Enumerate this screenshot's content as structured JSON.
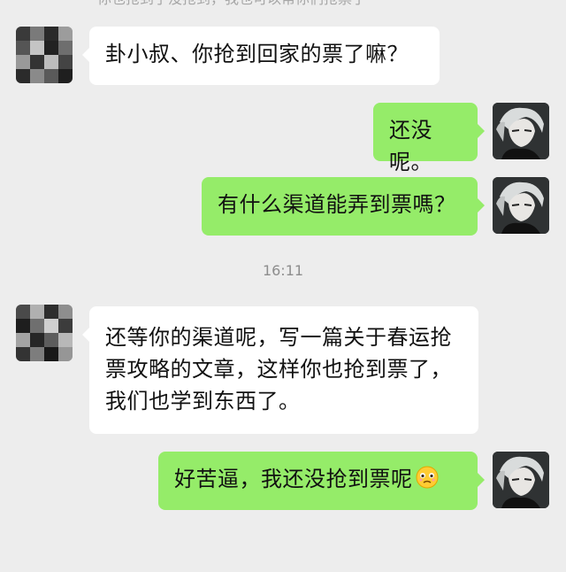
{
  "chat": {
    "top_partial_text": "你也抢到了没抢到，我也可以帮你们抢票了",
    "messages": [
      {
        "side": "left",
        "text": "卦小叔、你抢到回家的票了嘛？"
      },
      {
        "side": "right",
        "text": "还没呢。"
      },
      {
        "side": "right",
        "text": "有什么渠道能弄到票嗎？"
      },
      {
        "side": "left",
        "text": "还等你的渠道呢，写一篇关于春运抢票攻略的文章，这样你也抢到票了，我们也学到东西了。"
      },
      {
        "side": "right",
        "text": "好苦逼，我还没抢到票呢"
      }
    ],
    "timestamp": "16:11"
  },
  "icons": {
    "emoji": "crying-face-emoji",
    "contact_avatar": "pixelated-avatar",
    "self_avatar": "anime-boy-avatar"
  },
  "colors": {
    "background": "#ededed",
    "bubble_right": "#95ec69",
    "bubble_left": "#ffffff"
  }
}
